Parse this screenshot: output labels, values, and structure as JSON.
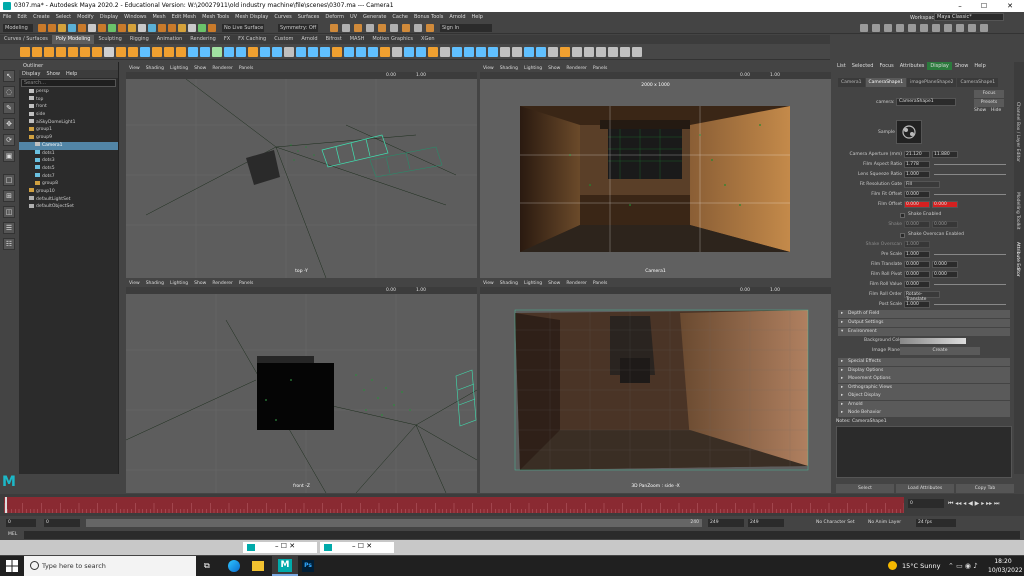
{
  "titlebar": {
    "title": "0307.ma* - Autodesk Maya 2020.2 - Educational Version: W:\\20027911\\old industry machine\\file\\scenes\\0307.ma  ---  Camera1"
  },
  "menubar": {
    "items": [
      "File",
      "Edit",
      "Create",
      "Select",
      "Modify",
      "Display",
      "Windows",
      "Mesh",
      "Edit Mesh",
      "Mesh Tools",
      "Mesh Display",
      "Curves",
      "Surfaces",
      "Deform",
      "UV",
      "Generate",
      "Cache",
      "Bonus Tools",
      "Arnold",
      "Help"
    ],
    "workspace_label": "Workspace :",
    "workspace_value": "Maya Classic*"
  },
  "statusline": {
    "mode": "Modeling",
    "live_surface": "No Live Surface",
    "symmetry": "Symmetry: Off",
    "signin": "Sign In"
  },
  "shelf": {
    "tabs": [
      "Curves / Surfaces",
      "Poly Modeling",
      "Sculpting",
      "Rigging",
      "Animation",
      "Rendering",
      "FX",
      "FX Caching",
      "Custom",
      "Arnold",
      "Bifrost",
      "MASH",
      "Motion Graphics",
      "XGen"
    ],
    "active_tab": 1
  },
  "outliner": {
    "title": "Outliner",
    "menu": [
      "Display",
      "Show",
      "Help"
    ],
    "search_placeholder": "Search...",
    "items": [
      {
        "label": "persp",
        "indent": 1
      },
      {
        "label": "top",
        "indent": 1
      },
      {
        "label": "front",
        "indent": 1
      },
      {
        "label": "side",
        "indent": 1
      },
      {
        "label": "aiSkyDomeLight1",
        "indent": 1
      },
      {
        "label": "group1",
        "indent": 1
      },
      {
        "label": "group9",
        "indent": 1
      },
      {
        "label": "Camera1",
        "indent": 2,
        "selected": true
      },
      {
        "label": "dots1",
        "indent": 2
      },
      {
        "label": "dots3",
        "indent": 2
      },
      {
        "label": "dots5",
        "indent": 2
      },
      {
        "label": "dots7",
        "indent": 2
      },
      {
        "label": "group8",
        "indent": 2
      },
      {
        "label": "group10",
        "indent": 1
      },
      {
        "label": "defaultLightSet",
        "indent": 1
      },
      {
        "label": "defaultObjectSet",
        "indent": 1
      }
    ]
  },
  "viewport_menu": [
    "View",
    "Shading",
    "Lighting",
    "Show",
    "Renderer",
    "Panels"
  ],
  "viewports": [
    {
      "label": "top -Y",
      "field": "0.00",
      "field2": "1.00"
    },
    {
      "label": "2000 x 1000",
      "sublabel": "Camera1",
      "field": "0.00",
      "field2": "1.00"
    },
    {
      "label": "front -Z",
      "field": "0.00",
      "field2": "1.00"
    },
    {
      "label": "3D PanZoom : side -X",
      "field": "0.00",
      "field2": "1.00"
    }
  ],
  "attribute_editor": {
    "menu": [
      "List",
      "Selected",
      "Focus",
      "Attributes",
      "Display",
      "Show",
      "Help"
    ],
    "tabs": [
      "Camera1",
      "CameraShape1",
      "imagePlaneShape2",
      "CameraShape1"
    ],
    "active_tab": 1,
    "camera_label": "camera:",
    "camera_value": "CameraShape1",
    "focus_btn": "Focus",
    "presets_btn": "Presets",
    "show_btn": "Show",
    "hide_btn": "Hide",
    "sample_label": "Sample",
    "rows": [
      {
        "label": "Camera Aperture (mm)",
        "v1": "21.120",
        "v2": "11.880"
      },
      {
        "label": "Film Aspect Ratio",
        "v1": "1.778"
      },
      {
        "label": "Lens Squeeze Ratio",
        "v1": "1.000"
      },
      {
        "label": "Fit Resolution Gate",
        "v1": "Fill"
      },
      {
        "label": "Film Fit Offset",
        "v1": "0.000"
      },
      {
        "label": "Film Offset",
        "v1": "0.000",
        "v2": "0.000",
        "red": true
      },
      {
        "label": "",
        "v1": "Shake Enabled",
        "check": true
      },
      {
        "label": "Shake",
        "v1": "0.000",
        "v2": "0.000",
        "dim": true
      },
      {
        "label": "",
        "v1": "Shake Overscan Enabled",
        "check": true
      },
      {
        "label": "Shake Overscan",
        "v1": "1.000",
        "dim": true
      },
      {
        "label": "Pre Scale",
        "v1": "1.000"
      },
      {
        "label": "Film Translate",
        "v1": "0.000",
        "v2": "0.000"
      },
      {
        "label": "Film Roll Pivot",
        "v1": "0.000",
        "v2": "0.000"
      },
      {
        "label": "Film Roll Value",
        "v1": "0.000"
      },
      {
        "label": "Film Roll Order",
        "v1": "Rotate-Translate"
      },
      {
        "label": "Post Scale",
        "v1": "1.000"
      }
    ],
    "sections_a": [
      "Depth of Field",
      "Output Settings",
      "Environment"
    ],
    "env_bg_label": "Background Color",
    "env_image_label": "Image Plane",
    "env_create_btn": "Create",
    "sections_b": [
      "Special Effects",
      "Display Options",
      "Movement Options",
      "Orthographic Views",
      "Object Display",
      "Arnold",
      "Node Behavior"
    ],
    "notes_label": "Notes: CameraShape1",
    "bottom_buttons": [
      "Select",
      "Load Attributes",
      "Copy Tab"
    ]
  },
  "side_tabs": [
    "Channel Box / Layer Editor",
    "Modelling Toolkit",
    "Attribute Editor"
  ],
  "timeline": {
    "current_frame": "0",
    "range_start": "0",
    "range_start2": "0",
    "range_end_inner": "240",
    "range_end": "249",
    "range_end2": "249",
    "character_set": "No Character Set",
    "anim_layer": "No Anim Layer",
    "fps": "24 fps"
  },
  "mel": {
    "label": "MEL"
  },
  "taskbar": {
    "search_placeholder": "Type here to search",
    "weather": "15°C  Sunny",
    "time": "18:20",
    "date": "10/03/2022"
  }
}
